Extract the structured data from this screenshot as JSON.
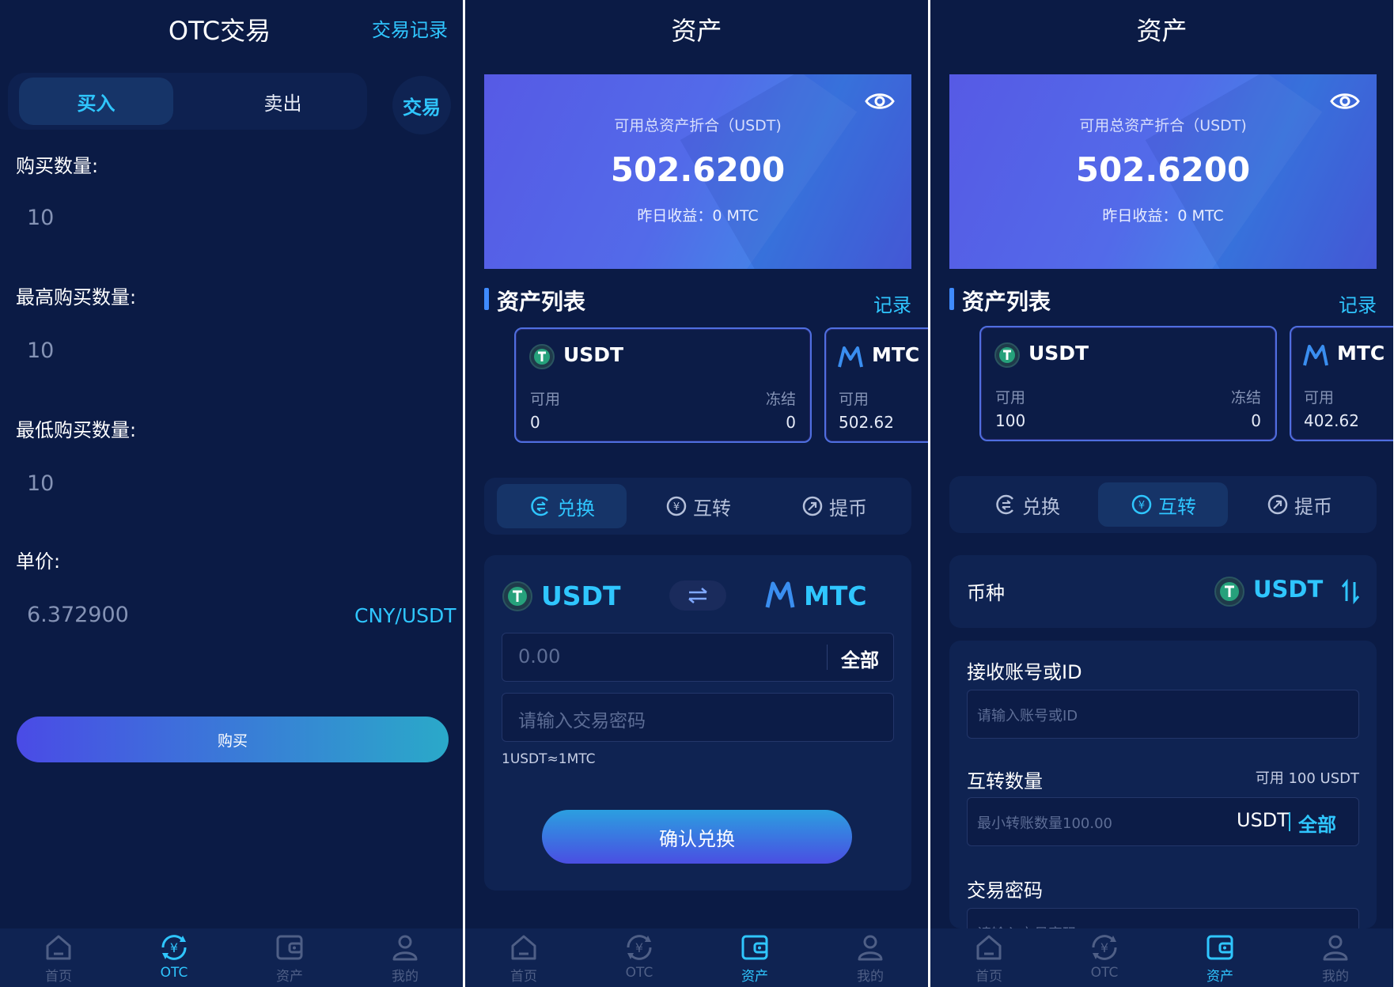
{
  "colors": {
    "bg": "#0b1b45",
    "accent": "#2fc6ff",
    "muted": "#8593b5",
    "panel": "#0f2352"
  },
  "tabbar": {
    "items": [
      {
        "label": "首页",
        "icon": "home-icon"
      },
      {
        "label": "OTC",
        "icon": "otc-icon"
      },
      {
        "label": "资产",
        "icon": "wallet-icon"
      },
      {
        "label": "我的",
        "icon": "user-icon"
      }
    ]
  },
  "otc": {
    "title": "OTC交易",
    "records_link": "交易记录",
    "tab_buy": "买入",
    "tab_sell": "卖出",
    "trade_badge": "交易",
    "buy_qty_label": "购买数量:",
    "buy_qty_value": "10",
    "max_qty_label": "最高购买数量:",
    "max_qty_value": "10",
    "min_qty_label": "最低购买数量:",
    "min_qty_value": "10",
    "price_label": "单价:",
    "price_value": "6.372900",
    "price_unit": "CNY/USDT",
    "buy_button": "购买"
  },
  "assets_common": {
    "title": "资产",
    "banner_caption": "可用总资产折合（USDT)",
    "banner_amount": "502.6200",
    "banner_yesterday": "昨日收益：0 MTC",
    "list_title": "资产列表",
    "records_link": "记录",
    "available_label": "可用",
    "frozen_label": "冻结",
    "op_exchange": "兑换",
    "op_transfer": "互转",
    "op_withdraw": "提币"
  },
  "assets_exchange": {
    "usdt_name": "USDT",
    "usdt_available": "0",
    "usdt_frozen": "0",
    "mtc_name": "MTC",
    "mtc_available": "502.62",
    "from_coin": "USDT",
    "to_coin": "MTC",
    "amount_placeholder": "0.00",
    "all_button": "全部",
    "password_placeholder": "请输入交易密码",
    "rate": "1USDT≈1MTC",
    "confirm_button": "确认兑换"
  },
  "assets_transfer": {
    "usdt_name": "USDT",
    "usdt_available": "100",
    "usdt_frozen": "0",
    "mtc_name": "MTC",
    "mtc_available": "402.62",
    "currency_label": "币种",
    "currency_value": "USDT",
    "receiver_label": "接收账号或ID",
    "receiver_placeholder": "请输入账号或ID",
    "amount_label": "互转数量",
    "amount_available": "可用 100 USDT",
    "amount_placeholder": "最小转账数量100.00",
    "amount_unit": "USDT",
    "all_button": "全部",
    "password_label": "交易密码",
    "password_placeholder": "请输入交易密码"
  }
}
